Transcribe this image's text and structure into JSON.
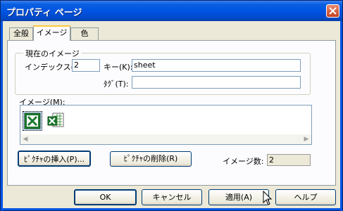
{
  "window": {
    "title": "プロパティ ページ"
  },
  "tabs": [
    {
      "label": "全般"
    },
    {
      "label": "イメージ"
    },
    {
      "label": "色"
    }
  ],
  "current_image": {
    "group_title": "現在のイメージ",
    "index_label": "インデックス(I):",
    "index_value": "2",
    "key_label": "キー(K):",
    "key_value": "sheet",
    "tag_label": "ﾀｸﾞ(T):",
    "tag_value": ""
  },
  "images": {
    "label": "イメージ(M):",
    "items": [
      {
        "icon": "excel-workbook-icon",
        "selected": true
      },
      {
        "icon": "excel-sheet-icon",
        "selected": false
      }
    ]
  },
  "picture_buttons": {
    "insert": "ﾋﾟｸﾁｬの挿入(P)...",
    "delete": "ﾋﾟｸﾁｬの削除(R)"
  },
  "image_count": {
    "label": "イメージ数:",
    "value": "2"
  },
  "footer": {
    "ok": "OK",
    "cancel": "キャンセル",
    "apply": "適用(A)",
    "help": "ヘルプ"
  }
}
